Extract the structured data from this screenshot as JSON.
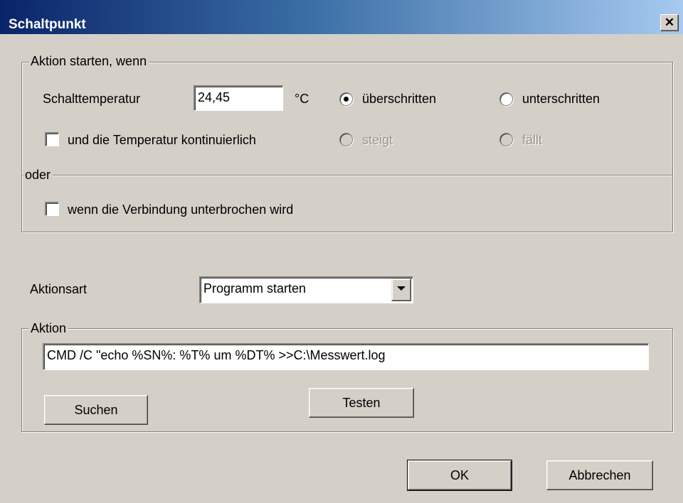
{
  "window": {
    "title": "Schaltpunkt",
    "close_glyph": "✕",
    "close_icon": "close-icon"
  },
  "condition_group": {
    "legend": "Aktion starten, wenn",
    "temperature_label": "Schalttemperatur",
    "temperature_value": "24,45",
    "unit": "°C",
    "radio_exceeded": {
      "label": "überschritten",
      "checked": true
    },
    "radio_below": {
      "label": "unterschritten",
      "checked": false
    },
    "continuous_checkbox": {
      "label": "und die Temperatur kontinuierlich",
      "checked": false
    },
    "radio_rising": {
      "label": "steigt",
      "enabled": false
    },
    "radio_falling": {
      "label": "fällt",
      "enabled": false
    },
    "or_legend": "oder",
    "connection_checkbox": {
      "label": "wenn die Verbindung unterbrochen wird",
      "checked": false
    }
  },
  "action_type": {
    "label": "Aktionsart",
    "selected": "Programm starten"
  },
  "action_group": {
    "legend": "Aktion",
    "command": "CMD /C \"echo %SN%: %T% um %DT% >>C:\\Messwert.log",
    "search_button": "Suchen",
    "test_button": "Testen"
  },
  "footer": {
    "ok_button": "OK",
    "cancel_button": "Abbrechen"
  }
}
